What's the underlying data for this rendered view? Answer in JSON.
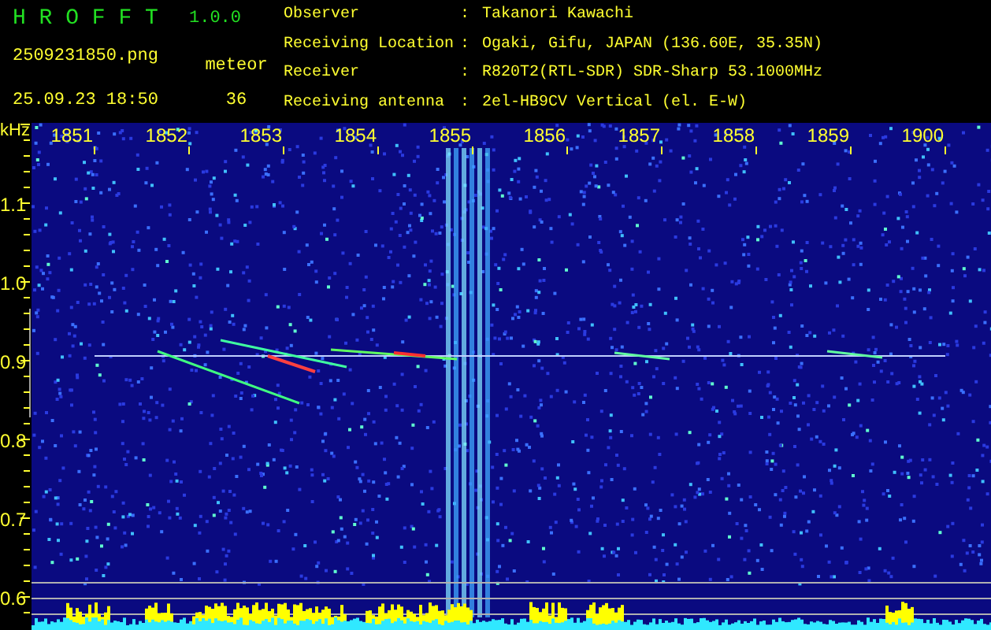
{
  "header": {
    "app_title": "H R O F F T",
    "version": "1.0.0",
    "filename": "2509231850.png",
    "timestamp": "25.09.23 18:50",
    "meteor_label": "meteor",
    "meteor_count": "36",
    "info": [
      {
        "label": "Observer",
        "separator": ":",
        "value": "Takanori Kawachi"
      },
      {
        "label": "Receiving Location",
        "separator": ":",
        "value": "Ogaki, Gifu, JAPAN (136.60E, 35.35N)"
      },
      {
        "label": "Receiver",
        "separator": ":",
        "value": "R820T2(RTL-SDR) SDR-Sharp 53.1000MHz"
      },
      {
        "label": "Receiving antenna",
        "separator": ":",
        "value": "2el-HB9CV Vertical (el. E-W)"
      }
    ]
  },
  "spectrogram": {
    "unit": "kHz",
    "x_ticks": [
      "1851",
      "1852",
      "1853",
      "1854",
      "1855",
      "1856",
      "1857",
      "1858",
      "1859",
      "1900"
    ],
    "y_ticks": [
      "1.1",
      "1.0",
      "0.9",
      "0.8",
      "0.7",
      "0.6"
    ]
  }
}
